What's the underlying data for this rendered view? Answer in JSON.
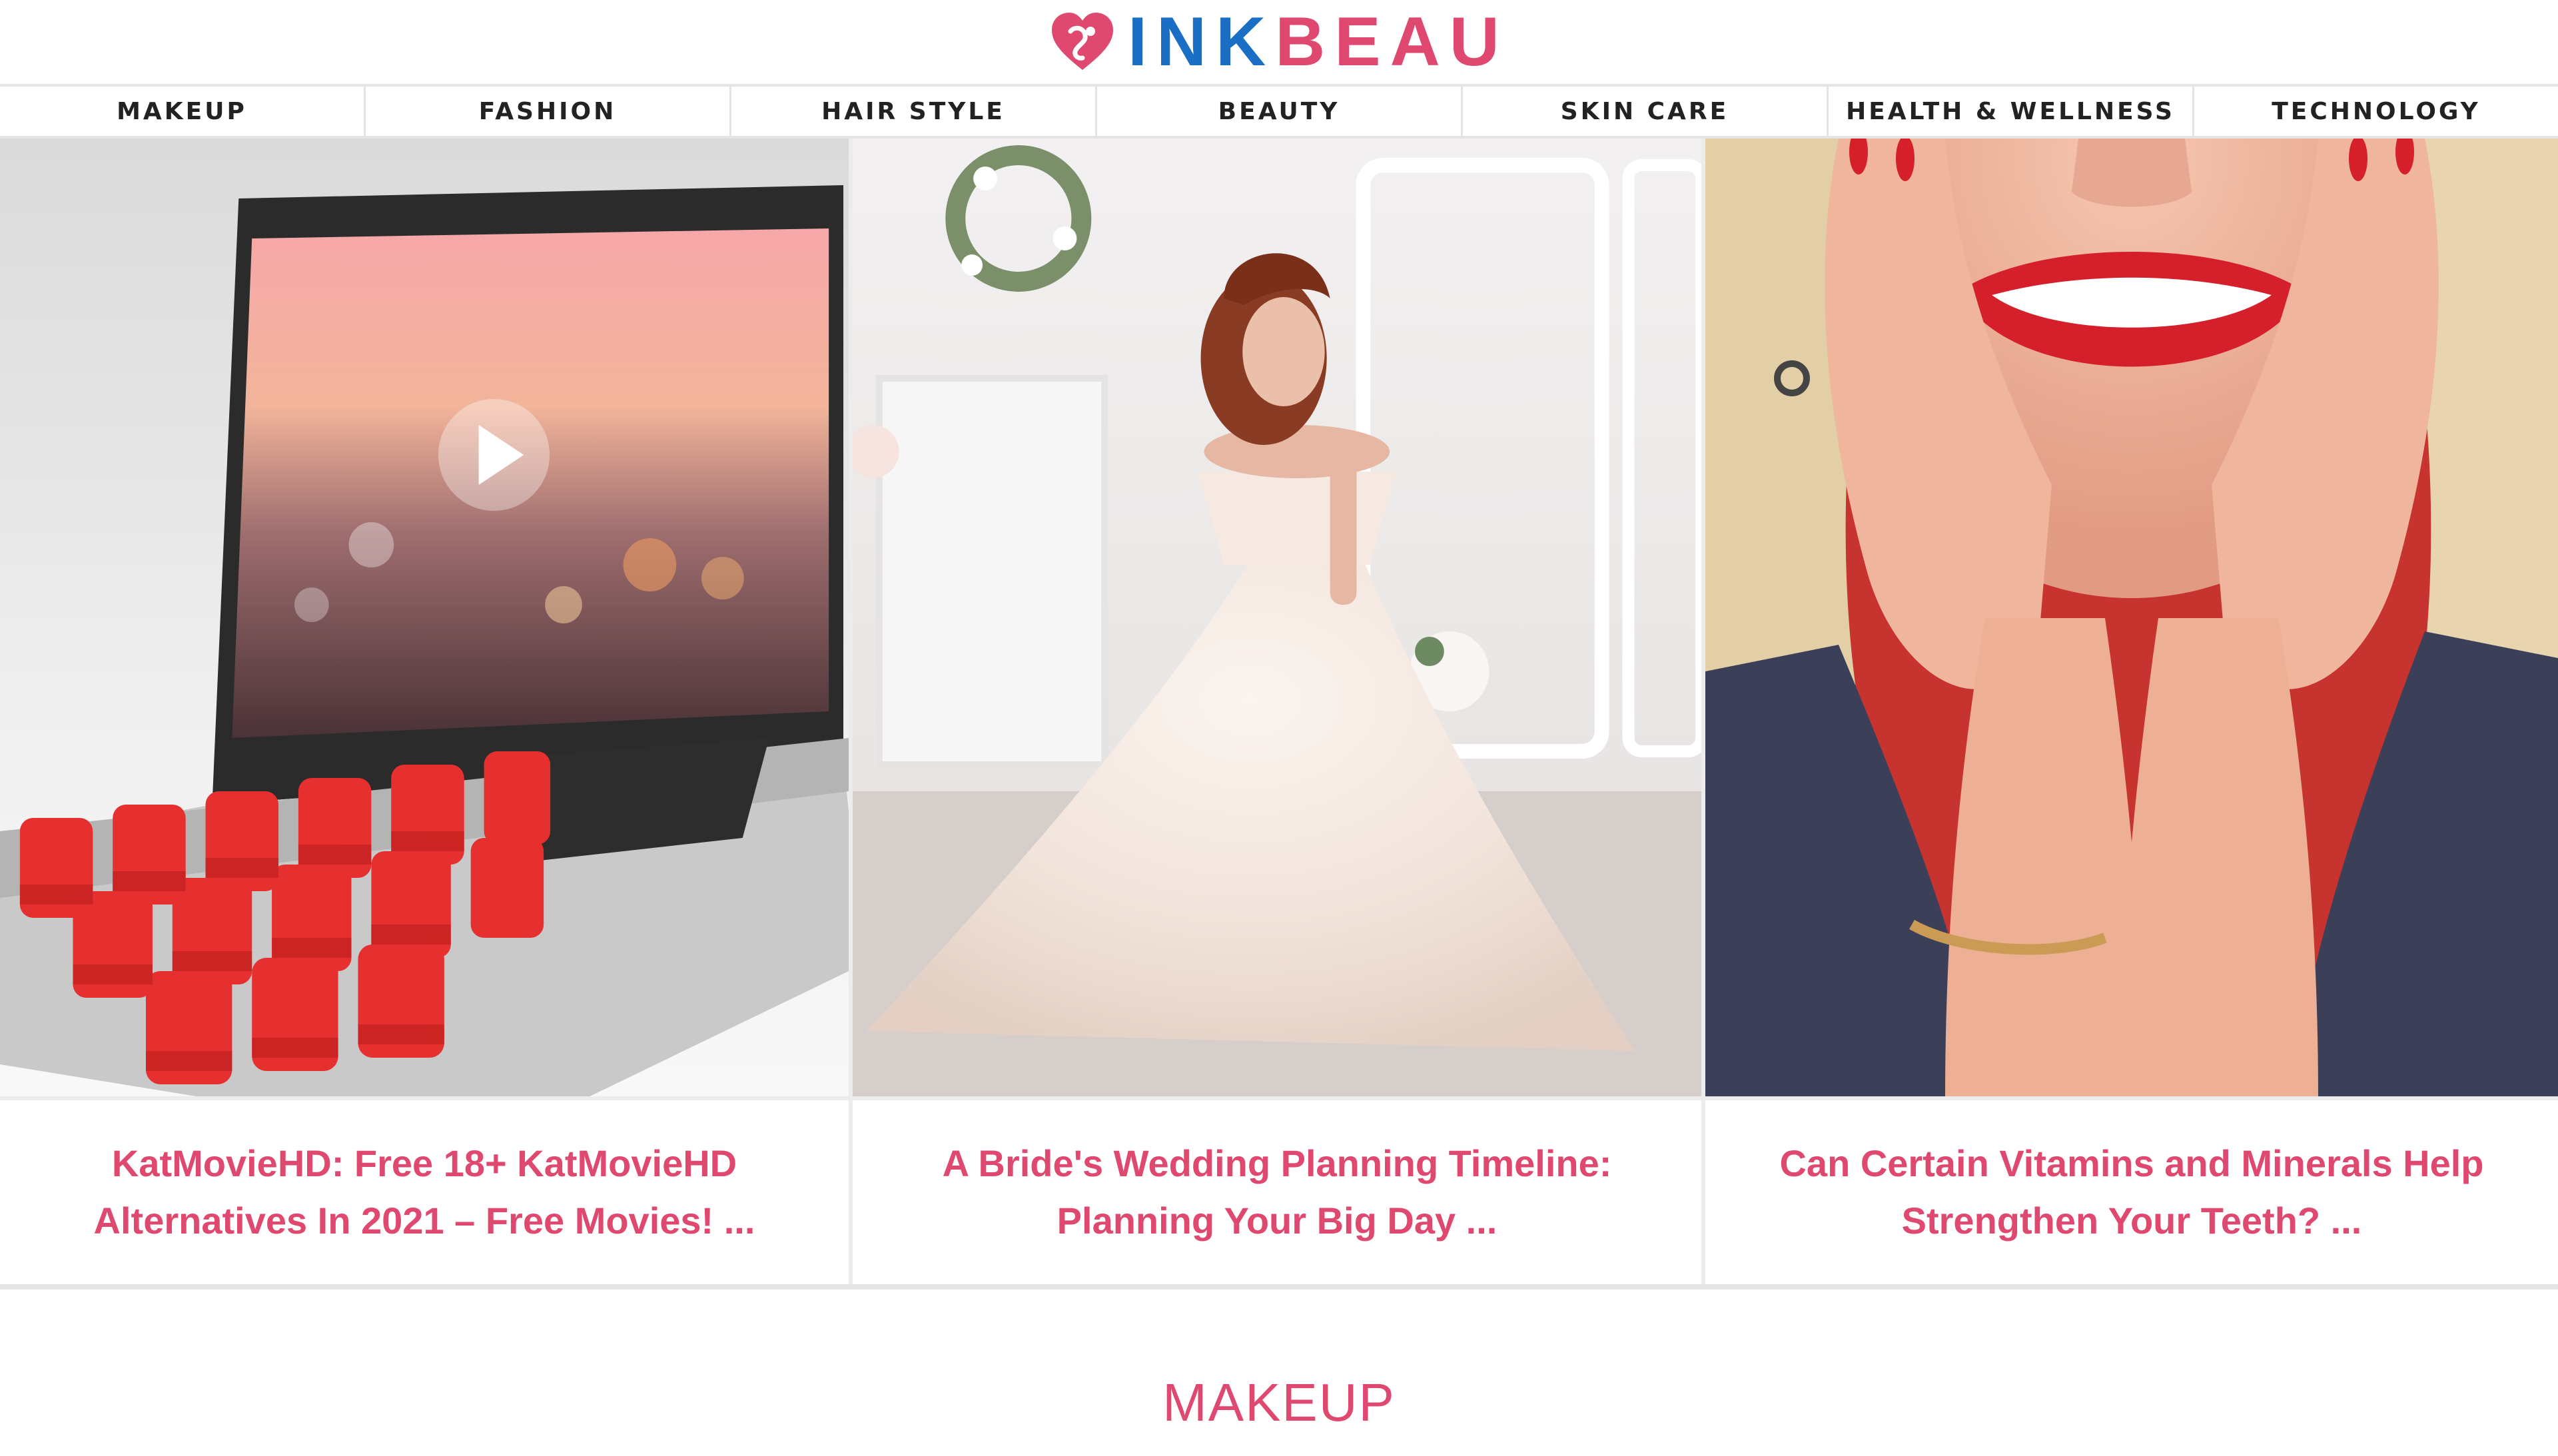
{
  "header": {
    "logo_part1": "INK",
    "logo_part2": "BEAU",
    "logo_icon": "heart-logo-icon"
  },
  "nav": {
    "items": [
      {
        "label": "MAKEUP"
      },
      {
        "label": "FASHION"
      },
      {
        "label": "HAIR STYLE"
      },
      {
        "label": "BEAUTY"
      },
      {
        "label": "SKIN CARE"
      },
      {
        "label": "HEALTH & WELLNESS"
      },
      {
        "label": "TECHNOLOGY"
      }
    ]
  },
  "cards": [
    {
      "title": "KatMovieHD: Free 18+ KatMovieHD Alternatives In 2021 – Free Movies! ..."
    },
    {
      "title": "A Bride's Wedding Planning Timeline: Planning Your Big Day ..."
    },
    {
      "title": "Can Certain Vitamins and Minerals Help Strengthen Your Teeth? ..."
    }
  ],
  "section": {
    "title": "MAKEUP"
  },
  "colors": {
    "brand_pink": "#e0496f",
    "brand_blue": "#1a6fc4"
  }
}
